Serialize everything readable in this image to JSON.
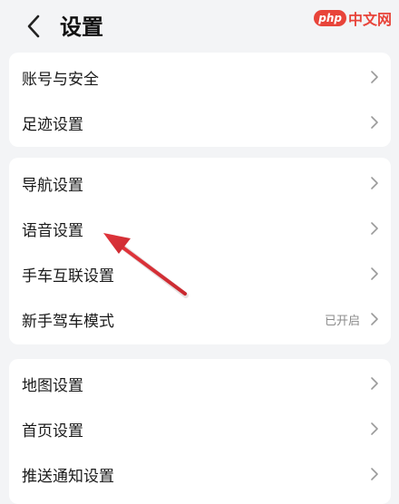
{
  "header": {
    "title": "设置"
  },
  "watermark": {
    "logo": "php",
    "text": "中文网"
  },
  "groups": [
    {
      "items": [
        {
          "label": "账号与安全"
        },
        {
          "label": "足迹设置"
        }
      ]
    },
    {
      "items": [
        {
          "label": "导航设置"
        },
        {
          "label": "语音设置"
        },
        {
          "label": "手车互联设置"
        },
        {
          "label": "新手驾车模式",
          "value": "已开启"
        }
      ]
    },
    {
      "items": [
        {
          "label": "地图设置"
        },
        {
          "label": "首页设置"
        },
        {
          "label": "推送通知设置"
        }
      ]
    }
  ],
  "colors": {
    "background": "#f3f4f6",
    "card": "#ffffff",
    "arrow": "#d9363e",
    "watermark": "#e8443a"
  },
  "icons": {
    "back": "chevron-left-icon",
    "row": "chevron-right-icon"
  }
}
